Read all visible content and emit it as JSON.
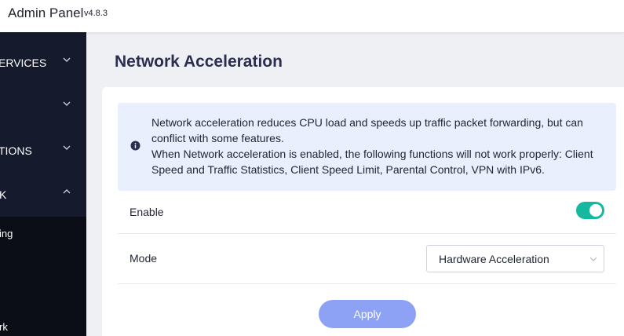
{
  "header": {
    "app_title": "Admin Panel",
    "version": "v4.8.3"
  },
  "sidebar": {
    "items": [
      {
        "label": "ERVICES",
        "expanded": false,
        "icon": "chevron-down-icon"
      },
      {
        "label": "",
        "expanded": false,
        "icon": "chevron-down-icon"
      },
      {
        "label": "TIONS",
        "expanded": false,
        "icon": "chevron-down-icon"
      },
      {
        "label": "K",
        "expanded": true,
        "icon": "chevron-up-icon"
      }
    ],
    "sub_items": [
      {
        "label": "ing"
      },
      {
        "label": "rk"
      }
    ]
  },
  "page": {
    "title": "Network Acceleration"
  },
  "info": {
    "icon": "info-icon",
    "line1": "Network acceleration reduces CPU load and speeds up traffic packet forwarding, but can conflict with some features.",
    "line2": "When Network acceleration is enabled, the following functions will not work properly: Client Speed and Traffic Statistics, Client Speed Limit, Parental Control, VPN with IPv6."
  },
  "settings": {
    "enable_label": "Enable",
    "enable_value": true,
    "mode_label": "Mode",
    "mode_value": "Hardware Acceleration"
  },
  "actions": {
    "apply_label": "Apply"
  },
  "colors": {
    "sidebar_bg": "#151a2d",
    "submenu_bg": "#0c0e17",
    "toggle_on": "#16b89f",
    "apply_button": "#8da2f4",
    "info_bg": "#e9effc",
    "title_color": "#2a2f52"
  }
}
